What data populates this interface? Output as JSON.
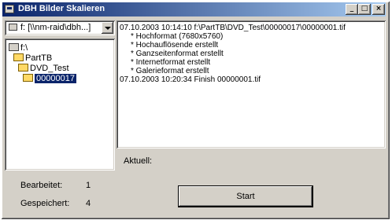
{
  "window": {
    "title": "DBH Bilder Skalieren",
    "caption_buttons": {
      "minimize": "_",
      "maximize": "□",
      "close": "×"
    }
  },
  "drive_select": {
    "value": "f: [\\\\nm-raid\\dbh...]"
  },
  "folder_tree": {
    "items": [
      {
        "label": "f:\\",
        "selected": false
      },
      {
        "label": "PartTB",
        "selected": false
      },
      {
        "label": "DVD_Test",
        "selected": false
      },
      {
        "label": "00000017",
        "selected": true
      }
    ]
  },
  "log": {
    "lines": [
      "07.10.2003 10:14:10 f:\\PartTB\\DVD_Test\\00000017\\00000001.tif",
      "* Hochformat (7680x5760)",
      "* Hochauflösende erstellt",
      "* Ganzseitenformat erstellt",
      "* Internetformat erstellt",
      "* Galerieformat erstellt",
      "07.10.2003 10:20:34 Finish 00000001.tif"
    ]
  },
  "status": {
    "aktuell_label": "Aktuell:",
    "bearbeitet_label": "Bearbeitet:",
    "bearbeitet_value": "1",
    "gespeichert_label": "Gespeichert:",
    "gespeichert_value": "4"
  },
  "start_button": {
    "label": "Start"
  }
}
